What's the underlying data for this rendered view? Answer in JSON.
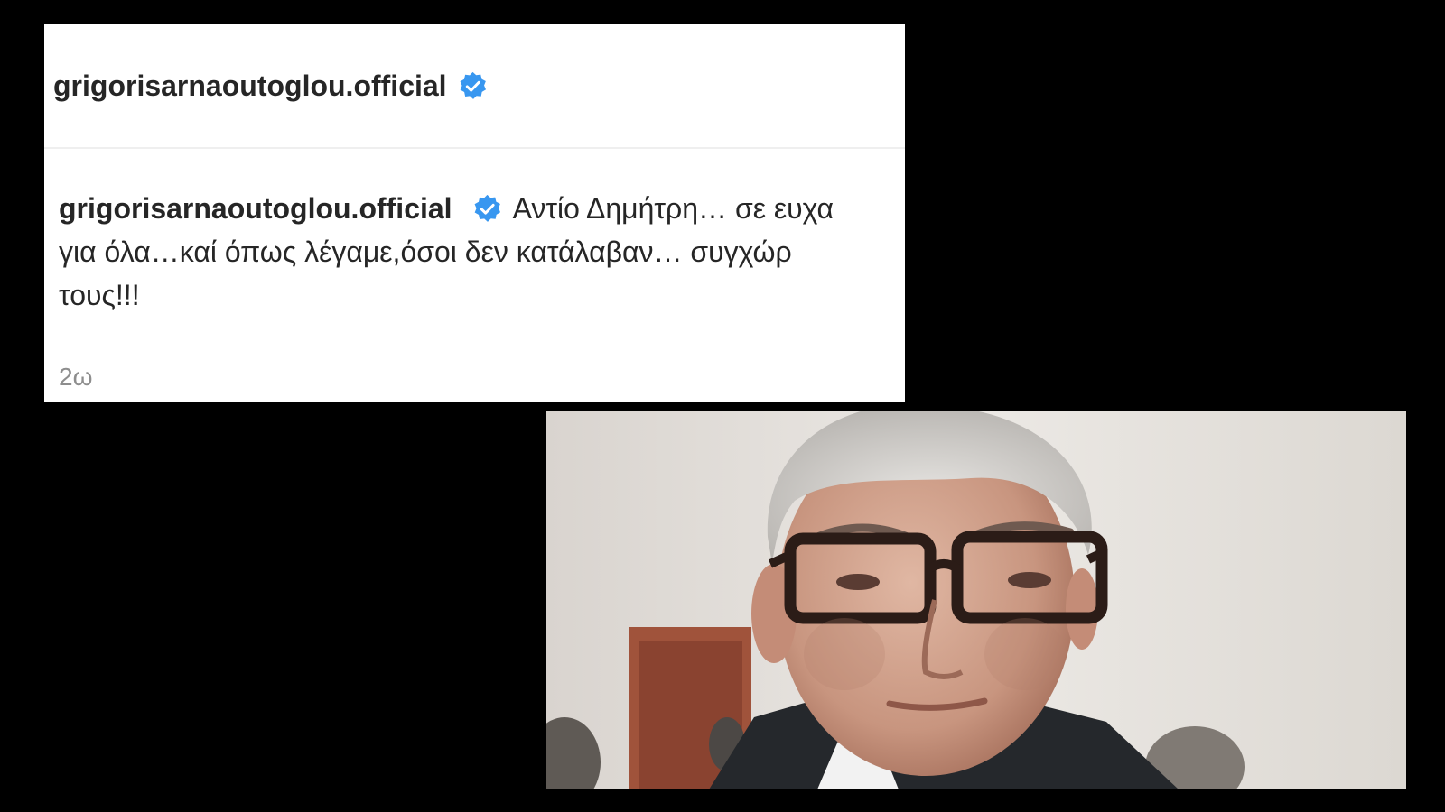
{
  "post": {
    "header_username": "grigorisarnaoutoglou.official",
    "caption_username": "grigorisarnaoutoglou.official",
    "caption_line1": "Αντίο Δημήτρη… σε ευχα",
    "caption_line2": "για όλα…καί όπως λέγαμε,όσοι δεν κατάλαβαν… συγχώρ",
    "caption_line3": "τους!!!",
    "timestamp": "2ω"
  },
  "icons": {
    "verified": "verified-badge-icon"
  },
  "colors": {
    "background": "#000000",
    "card": "#ffffff",
    "text": "#262626",
    "muted": "#8e8e8e",
    "verified": "#3897f0"
  }
}
